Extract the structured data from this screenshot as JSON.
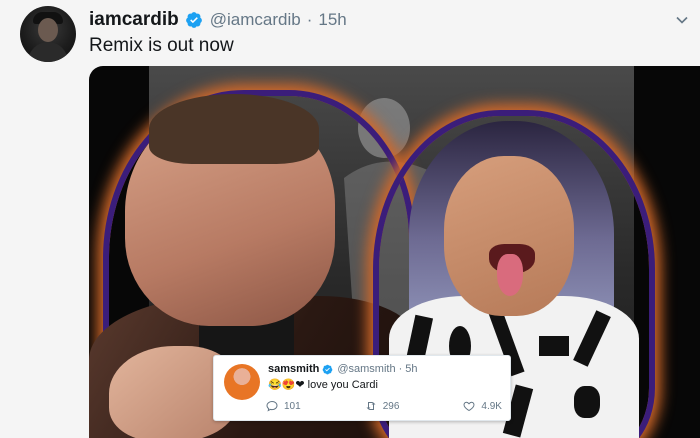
{
  "tweet": {
    "display_name": "iamcardib",
    "handle": "@iamcardib",
    "separator": "·",
    "time": "15h",
    "text": "Remix is out now"
  },
  "embedded_tweet": {
    "display_name": "samsmith",
    "handle": "@samsmith",
    "separator": "·",
    "time": "5h",
    "emojis": "😂😍❤",
    "text": "love you Cardi",
    "replies": "101",
    "retweets": "296",
    "likes": "4.9K"
  },
  "colors": {
    "verified": "#1da1f2",
    "text_primary": "#14171a",
    "text_secondary": "#657786",
    "glow_orange": "#d2692a",
    "glow_purple": "#3b1d7a"
  }
}
